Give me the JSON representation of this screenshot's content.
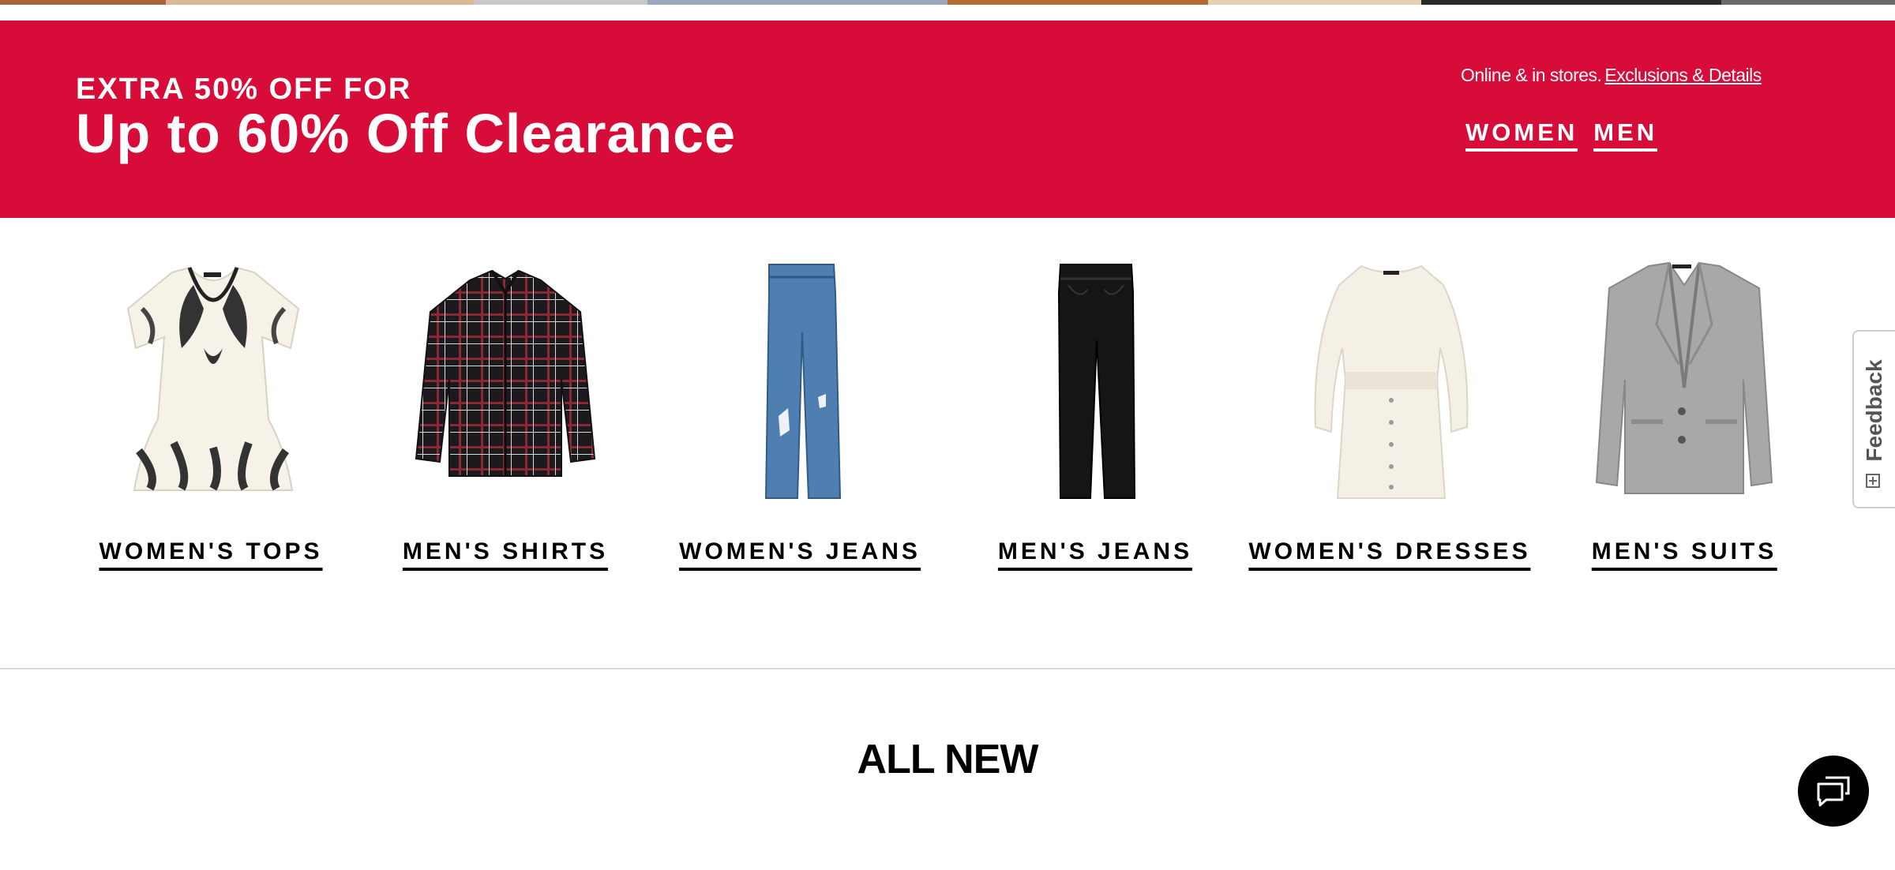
{
  "top_strip": {
    "colors": [
      "#a8643a",
      "#d9b892",
      "#c8c9cc",
      "#9aa9bc",
      "#b46b33",
      "#e4d1b2",
      "#2a2a2a",
      "#6b6b6b"
    ]
  },
  "promo": {
    "background_color": "#d80c38",
    "eyebrow": "EXTRA 50% OFF FOR",
    "title": "Up to 60% Off Clearance",
    "note": "Online & in stores.",
    "details_link": "Exclusions & Details",
    "links": [
      "WOMEN",
      "MEN"
    ]
  },
  "categories": [
    {
      "label": "WOMEN'S TOPS",
      "image_icon": "womens-top-icon"
    },
    {
      "label": "MEN'S SHIRTS",
      "image_icon": "mens-shirt-icon"
    },
    {
      "label": "WOMEN'S JEANS",
      "image_icon": "womens-jeans-icon"
    },
    {
      "label": "MEN'S JEANS",
      "image_icon": "mens-jeans-icon"
    },
    {
      "label": "WOMEN'S DRESSES",
      "image_icon": "womens-dress-icon"
    },
    {
      "label": "MEN'S SUITS",
      "image_icon": "mens-suit-icon"
    }
  ],
  "section": {
    "heading": "ALL NEW"
  },
  "feedback": {
    "label": "Feedback",
    "icon": "feedback-plus-icon"
  },
  "chat": {
    "icon": "chat-bubbles-icon"
  }
}
